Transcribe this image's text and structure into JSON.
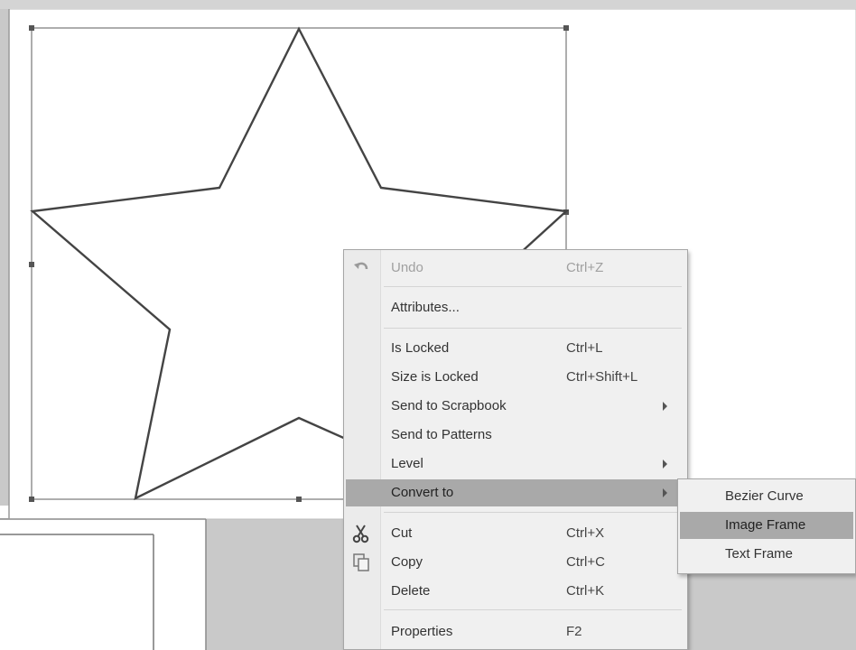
{
  "context_menu": {
    "undo": {
      "label": "Undo",
      "shortcut": "Ctrl+Z"
    },
    "attributes": {
      "label": "Attributes..."
    },
    "is_locked": {
      "label": "Is Locked",
      "shortcut": "Ctrl+L"
    },
    "size_is_locked": {
      "label": "Size is Locked",
      "shortcut": "Ctrl+Shift+L"
    },
    "send_to_scrapbook": {
      "label": "Send to Scrapbook"
    },
    "send_to_patterns": {
      "label": "Send to Patterns"
    },
    "level": {
      "label": "Level"
    },
    "convert_to": {
      "label": "Convert to"
    },
    "cut": {
      "label": "Cut",
      "shortcut": "Ctrl+X"
    },
    "copy": {
      "label": "Copy",
      "shortcut": "Ctrl+C"
    },
    "delete": {
      "label": "Delete",
      "shortcut": "Ctrl+K"
    },
    "properties": {
      "label": "Properties",
      "shortcut": "F2"
    }
  },
  "submenu": {
    "bezier_curve": "Bezier Curve",
    "image_frame": "Image Frame",
    "text_frame": "Text Frame"
  },
  "colors": {
    "menu_bg": "#f0f0f0",
    "highlight": "#a9a9a9",
    "page_bg": "#ffffff",
    "workspace": "#c9c9c9"
  }
}
